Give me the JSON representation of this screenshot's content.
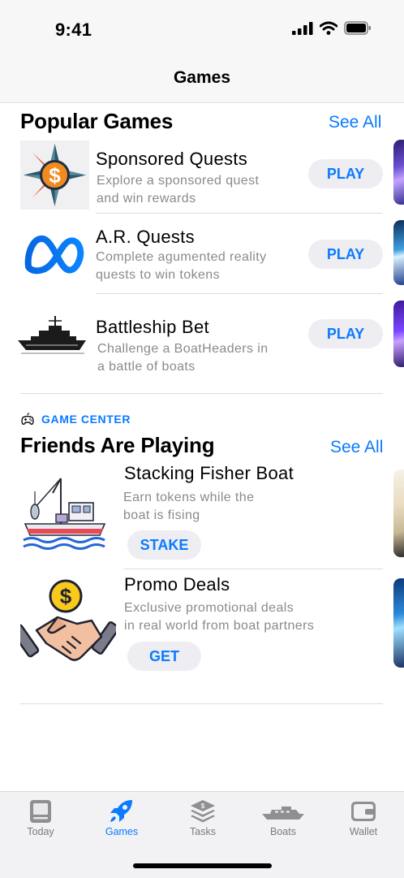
{
  "status_bar": {
    "time": "9:41"
  },
  "nav": {
    "title": "Games"
  },
  "popular": {
    "title": "Popular Games",
    "see_all": "See All",
    "items": [
      {
        "title": "Sponsored Quests",
        "sub1": "Explore a sponsored quest",
        "sub2": "and win rewards",
        "action": "PLAY",
        "icon": "compass-dollar-icon"
      },
      {
        "title": "A.R. Quests",
        "sub1": "Complete agumented reality",
        "sub2": "quests to win tokens",
        "action": "PLAY",
        "icon": "meta-infinity-icon"
      },
      {
        "title": "Battleship Bet",
        "sub1": "Challenge a BoatHeaders in",
        "sub2": "a battle of boats",
        "action": "PLAY",
        "icon": "battleship-icon"
      }
    ]
  },
  "friends": {
    "eyebrow": "GAME CENTER",
    "title": "Friends Are Playing",
    "see_all": "See All",
    "items": [
      {
        "title": "Stacking Fisher Boat",
        "sub1": "Earn tokens while the",
        "sub2": "boat is fising",
        "action": "STAKE",
        "icon": "fishing-boat-icon"
      },
      {
        "title": "Promo Deals",
        "sub1": "Exclusive promotional deals",
        "sub2": "in real world from boat partners",
        "action": "GET",
        "icon": "handshake-dollar-icon"
      }
    ]
  },
  "tabs": [
    {
      "label": "Today",
      "icon": "today-icon",
      "active": false
    },
    {
      "label": "Games",
      "icon": "rocket-icon",
      "active": true
    },
    {
      "label": "Tasks",
      "icon": "layers-icon",
      "active": false
    },
    {
      "label": "Boats",
      "icon": "boat-icon",
      "active": false
    },
    {
      "label": "Wallet",
      "icon": "wallet-icon",
      "active": false
    }
  ],
  "colors": {
    "accent": "#0a7aff",
    "pill_bg": "#eeeef2",
    "secondary_text": "#8a8a8e"
  }
}
